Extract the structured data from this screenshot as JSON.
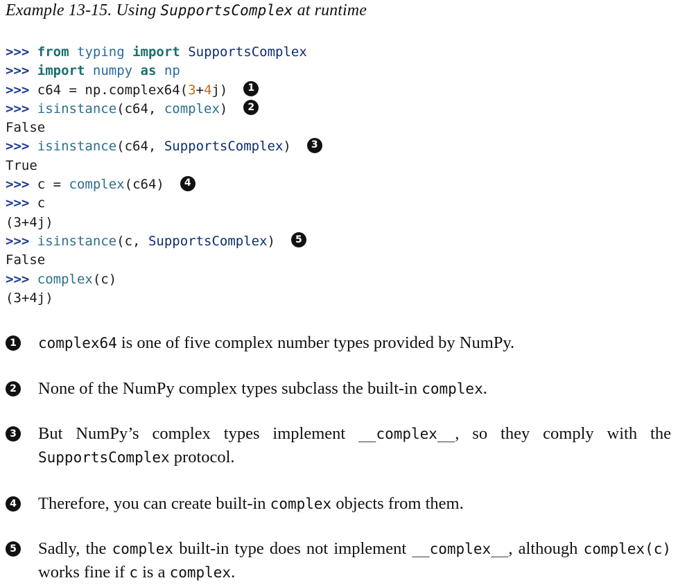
{
  "caption": {
    "prefix": "Example 13-15. Using ",
    "code": "SupportsComplex",
    "suffix": " at runtime"
  },
  "code_lines": [
    {
      "prompt": ">>>",
      "parts": [
        {
          "t": "from",
          "c": "kw"
        },
        {
          "t": " "
        },
        {
          "t": "typing",
          "c": "mod"
        },
        {
          "t": " "
        },
        {
          "t": "import",
          "c": "kw"
        },
        {
          "t": " "
        },
        {
          "t": "SupportsComplex",
          "c": "cls"
        }
      ]
    },
    {
      "prompt": ">>>",
      "parts": [
        {
          "t": "import",
          "c": "kw"
        },
        {
          "t": " "
        },
        {
          "t": "numpy",
          "c": "mod"
        },
        {
          "t": " "
        },
        {
          "t": "as",
          "c": "kw"
        },
        {
          "t": " "
        },
        {
          "t": "np",
          "c": "mod"
        }
      ]
    },
    {
      "prompt": ">>>",
      "parts": [
        {
          "t": "c64 = np.complex64("
        },
        {
          "t": "3",
          "c": "num"
        },
        {
          "t": "+"
        },
        {
          "t": "4",
          "c": "num"
        },
        {
          "t": "j)"
        }
      ],
      "callout": "1"
    },
    {
      "prompt": ">>>",
      "parts": [
        {
          "t": "isinstance",
          "c": "bi"
        },
        {
          "t": "(c64, "
        },
        {
          "t": "complex",
          "c": "bi"
        },
        {
          "t": ")"
        }
      ],
      "callout": "2"
    },
    {
      "output": "False"
    },
    {
      "prompt": ">>>",
      "parts": [
        {
          "t": "isinstance",
          "c": "bi"
        },
        {
          "t": "(c64, "
        },
        {
          "t": "SupportsComplex",
          "c": "cls"
        },
        {
          "t": ")"
        }
      ],
      "callout": "3"
    },
    {
      "output": "True"
    },
    {
      "prompt": ">>>",
      "parts": [
        {
          "t": "c = "
        },
        {
          "t": "complex",
          "c": "bi"
        },
        {
          "t": "(c64)"
        }
      ],
      "callout": "4"
    },
    {
      "prompt": ">>>",
      "parts": [
        {
          "t": "c"
        }
      ]
    },
    {
      "output": "(3+4j)"
    },
    {
      "prompt": ">>>",
      "parts": [
        {
          "t": "isinstance",
          "c": "bi"
        },
        {
          "t": "(c, "
        },
        {
          "t": "SupportsComplex",
          "c": "cls"
        },
        {
          "t": ")"
        }
      ],
      "callout": "5"
    },
    {
      "output": "False"
    },
    {
      "prompt": ">>>",
      "parts": [
        {
          "t": "complex",
          "c": "bi"
        },
        {
          "t": "(c)"
        }
      ]
    },
    {
      "output": "(3+4j)"
    }
  ],
  "notes": [
    {
      "callout": "1",
      "parts": [
        {
          "code": "complex64"
        },
        {
          "text": " is one of five complex number types provided by NumPy."
        }
      ]
    },
    {
      "callout": "2",
      "parts": [
        {
          "text": "None of the NumPy complex types subclass the built-in "
        },
        {
          "code": "complex"
        },
        {
          "text": "."
        }
      ]
    },
    {
      "callout": "3",
      "parts": [
        {
          "text": "But NumPy’s complex types implement "
        },
        {
          "code": "__complex__"
        },
        {
          "text": ", so they comply with the "
        },
        {
          "code": "SupportsComplex"
        },
        {
          "text": " protocol."
        }
      ]
    },
    {
      "callout": "4",
      "parts": [
        {
          "text": "Therefore, you can create built-in "
        },
        {
          "code": "complex"
        },
        {
          "text": " objects from them."
        }
      ]
    },
    {
      "callout": "5",
      "parts": [
        {
          "text": "Sadly, the "
        },
        {
          "code": "complex"
        },
        {
          "text": " built-in type does not implement "
        },
        {
          "code": "__complex__"
        },
        {
          "text": ", although "
        },
        {
          "code": "complex(c)"
        },
        {
          "text": " works fine if "
        },
        {
          "code": "c"
        },
        {
          "text": " is a "
        },
        {
          "code": "complex"
        },
        {
          "text": "."
        }
      ]
    }
  ]
}
